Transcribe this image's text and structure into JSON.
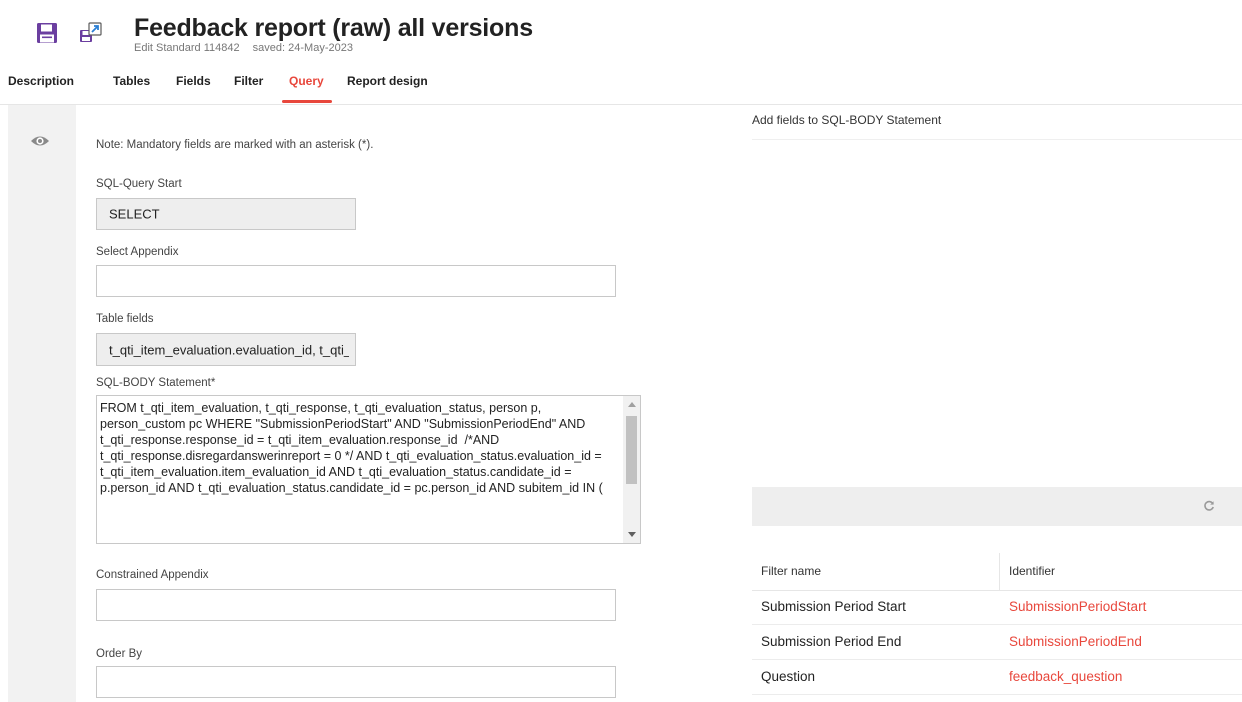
{
  "header": {
    "title": "Feedback report (raw) all versions",
    "edit_label": "Edit Standard 114842",
    "saved_label": "saved: 24-May-2023"
  },
  "icons": {
    "save": "save-icon",
    "export": "export-icon",
    "view": "eye-icon",
    "refresh": "refresh-icon"
  },
  "tabs": [
    {
      "label": "Description",
      "active": false
    },
    {
      "label": "Tables",
      "active": false
    },
    {
      "label": "Fields",
      "active": false
    },
    {
      "label": "Filter",
      "active": false
    },
    {
      "label": "Query",
      "active": true
    },
    {
      "label": "Report design",
      "active": false
    }
  ],
  "form": {
    "note": "Note: Mandatory fields are marked with an asterisk (*).",
    "sql_query_start": {
      "label": "SQL-Query Start",
      "value": "SELECT"
    },
    "select_appendix": {
      "label": "Select Appendix",
      "value": ""
    },
    "table_fields": {
      "label": "Table fields",
      "value": "t_qti_item_evaluation.evaluation_id, t_qti_response.response_id"
    },
    "sql_body": {
      "label": "SQL-BODY Statement*",
      "value": "FROM t_qti_item_evaluation, t_qti_response, t_qti_evaluation_status, person p, person_custom pc WHERE \"SubmissionPeriodStart\" AND \"SubmissionPeriodEnd\" AND t_qti_response.response_id = t_qti_item_evaluation.response_id  /*AND t_qti_response.disregardanswerinreport = 0 */ AND t_qti_evaluation_status.evaluation_id = t_qti_item_evaluation.item_evaluation_id AND t_qti_evaluation_status.candidate_id = p.person_id AND t_qti_evaluation_status.candidate_id = pc.person_id AND subitem_id IN ("
    },
    "constrained_appendix": {
      "label": "Constrained Appendix",
      "value": ""
    },
    "order_by": {
      "label": "Order By",
      "value": ""
    }
  },
  "right_panel": {
    "heading": "Add fields to SQL-BODY Statement",
    "filter_table": {
      "columns": [
        "Filter name",
        "Identifier"
      ],
      "rows": [
        {
          "name": "Submission Period Start",
          "identifier": "SubmissionPeriodStart"
        },
        {
          "name": "Submission Period End",
          "identifier": "SubmissionPeriodEnd"
        },
        {
          "name": "Question",
          "identifier": "feedback_question"
        }
      ]
    }
  },
  "colors": {
    "accent": "#e8473c",
    "icon_purple": "#6b3fa0"
  }
}
